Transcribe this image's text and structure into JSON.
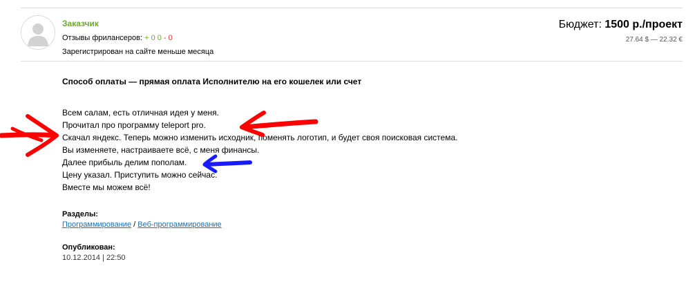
{
  "customer": {
    "name": "Заказчик",
    "reviews_label": "Отзывы фрилансеров:",
    "reviews_positive": "+ 0",
    "reviews_zero": "0",
    "reviews_negative": "- 0",
    "registered": "Зарегистрирован на сайте меньше месяца"
  },
  "budget": {
    "label": "Бюджет:",
    "value": "1500 р./проект",
    "conversion": "27.64 $ — 22.32 €"
  },
  "payment_method": "Способ оплаты — прямая оплата Исполнителю на его кошелек или счет",
  "description": [
    "Всем салам, есть отличная идея у меня.",
    "Прочитал про программу teleport pro.",
    "Скачал яндекс. Теперь можно изменить исходник, поменять логотип, и будет своя поисковая система.",
    "Вы изменяете, настраиваете всё, с меня финансы.",
    "Далее прибыль делим пополам.",
    "Цену указал. Приступить можно сейчас.",
    "Вместе мы можем всё!"
  ],
  "sections": {
    "label": "Разделы:",
    "links": [
      "Программирование",
      "Веб-программирование"
    ],
    "separator": " / "
  },
  "published": {
    "label": "Опубликован:",
    "date": "10.12.2014 | 22:50"
  },
  "colors": {
    "accent_green": "#6aaa2c",
    "link_blue": "#1a6fb0",
    "annotation_red": "#ff0000",
    "annotation_blue": "#1a1aff"
  }
}
